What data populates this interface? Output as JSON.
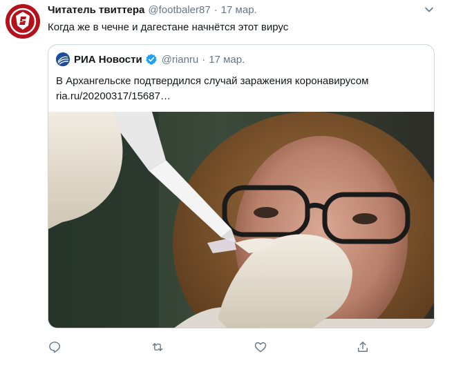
{
  "tweet": {
    "author_name": "Читатель твиттера",
    "author_handle": "@footbaler87",
    "separator": "·",
    "date": "17 мар.",
    "text": "Когда же в чечне и дагестане начнётся этот вирус",
    "avatar_icon": "spartak-logo-icon"
  },
  "quote": {
    "author_name": "РИА Новости",
    "author_handle": "@rianru",
    "separator": "·",
    "date": "17 мар.",
    "text": "В Архангельске подтвердился случай заражения коронавирусом",
    "link": "ria.ru/20200317/15687…",
    "logo_icon": "ria-logo-icon",
    "verified_icon": "verified-badge-icon"
  },
  "actions": {
    "icons": [
      "reply-icon",
      "retweet-icon",
      "like-icon",
      "share-icon"
    ]
  },
  "colors": {
    "text": "#14171a",
    "secondary": "#657786",
    "accent": "#1da1f2",
    "border": "#ccd6dd",
    "avatar_red": "#b3121d",
    "ria_blue": "#1c4e9b"
  }
}
